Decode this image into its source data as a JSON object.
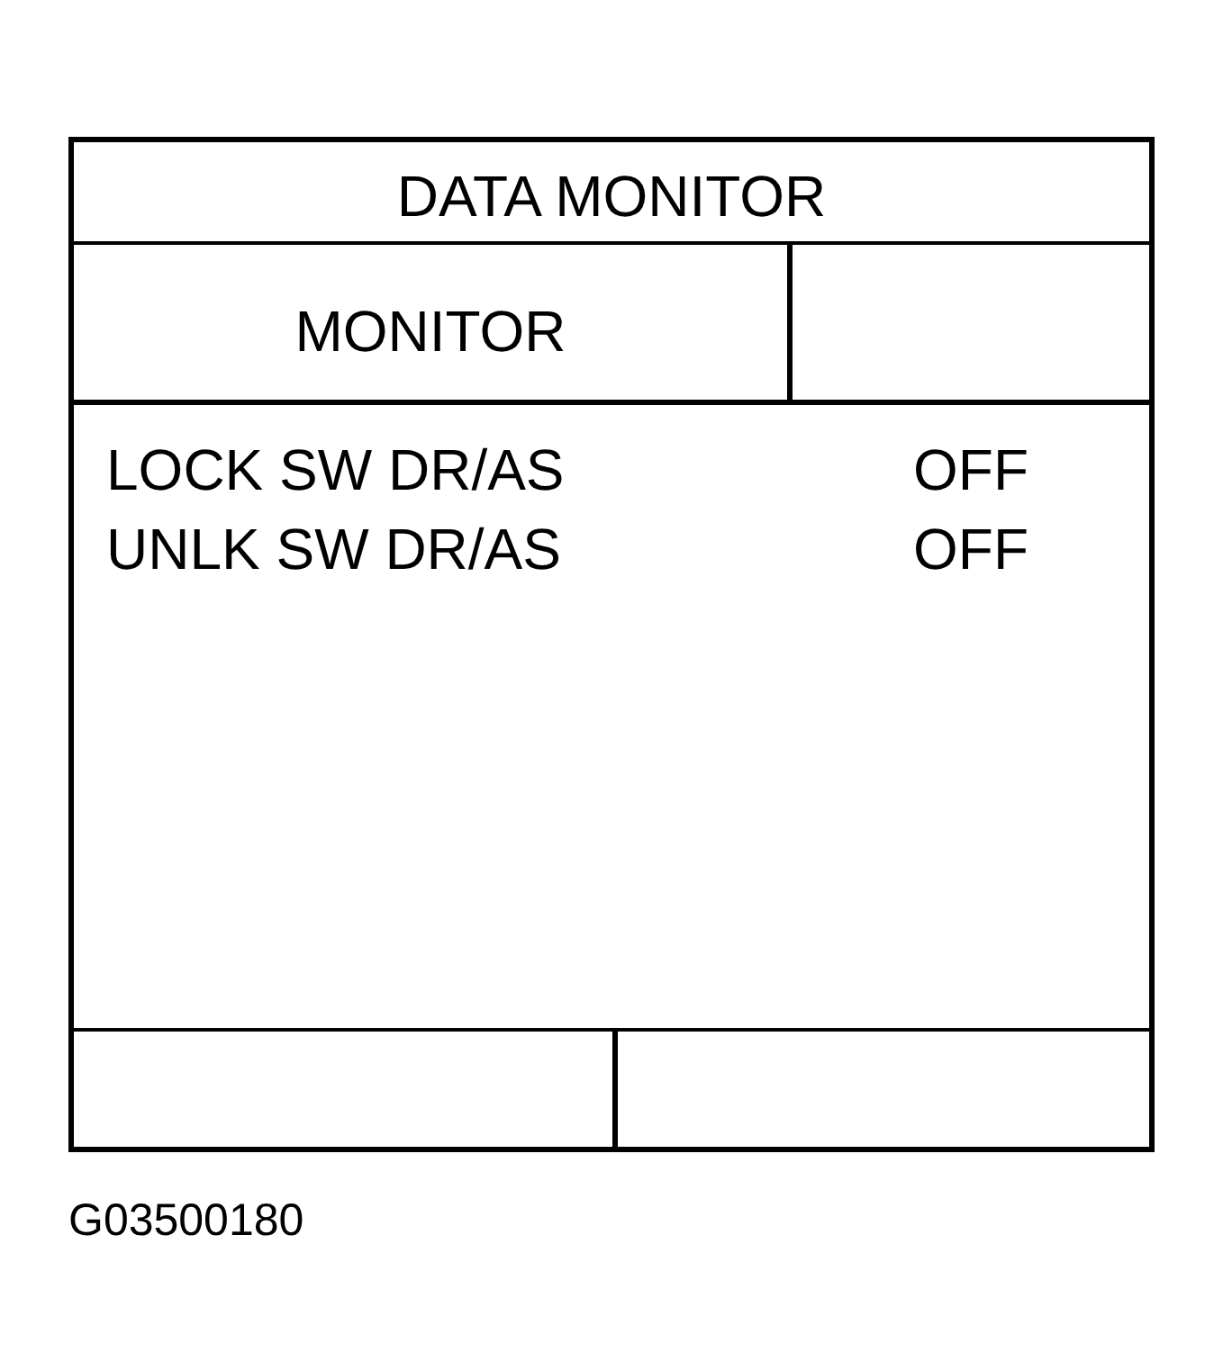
{
  "window": {
    "title": "DATA MONITOR"
  },
  "header": {
    "column_1": "MONITOR"
  },
  "rows": [
    {
      "label": "LOCK SW DR/AS",
      "value": "OFF"
    },
    {
      "label": "UNLK SW DR/AS",
      "value": "OFF"
    }
  ],
  "caption": "G03500180"
}
